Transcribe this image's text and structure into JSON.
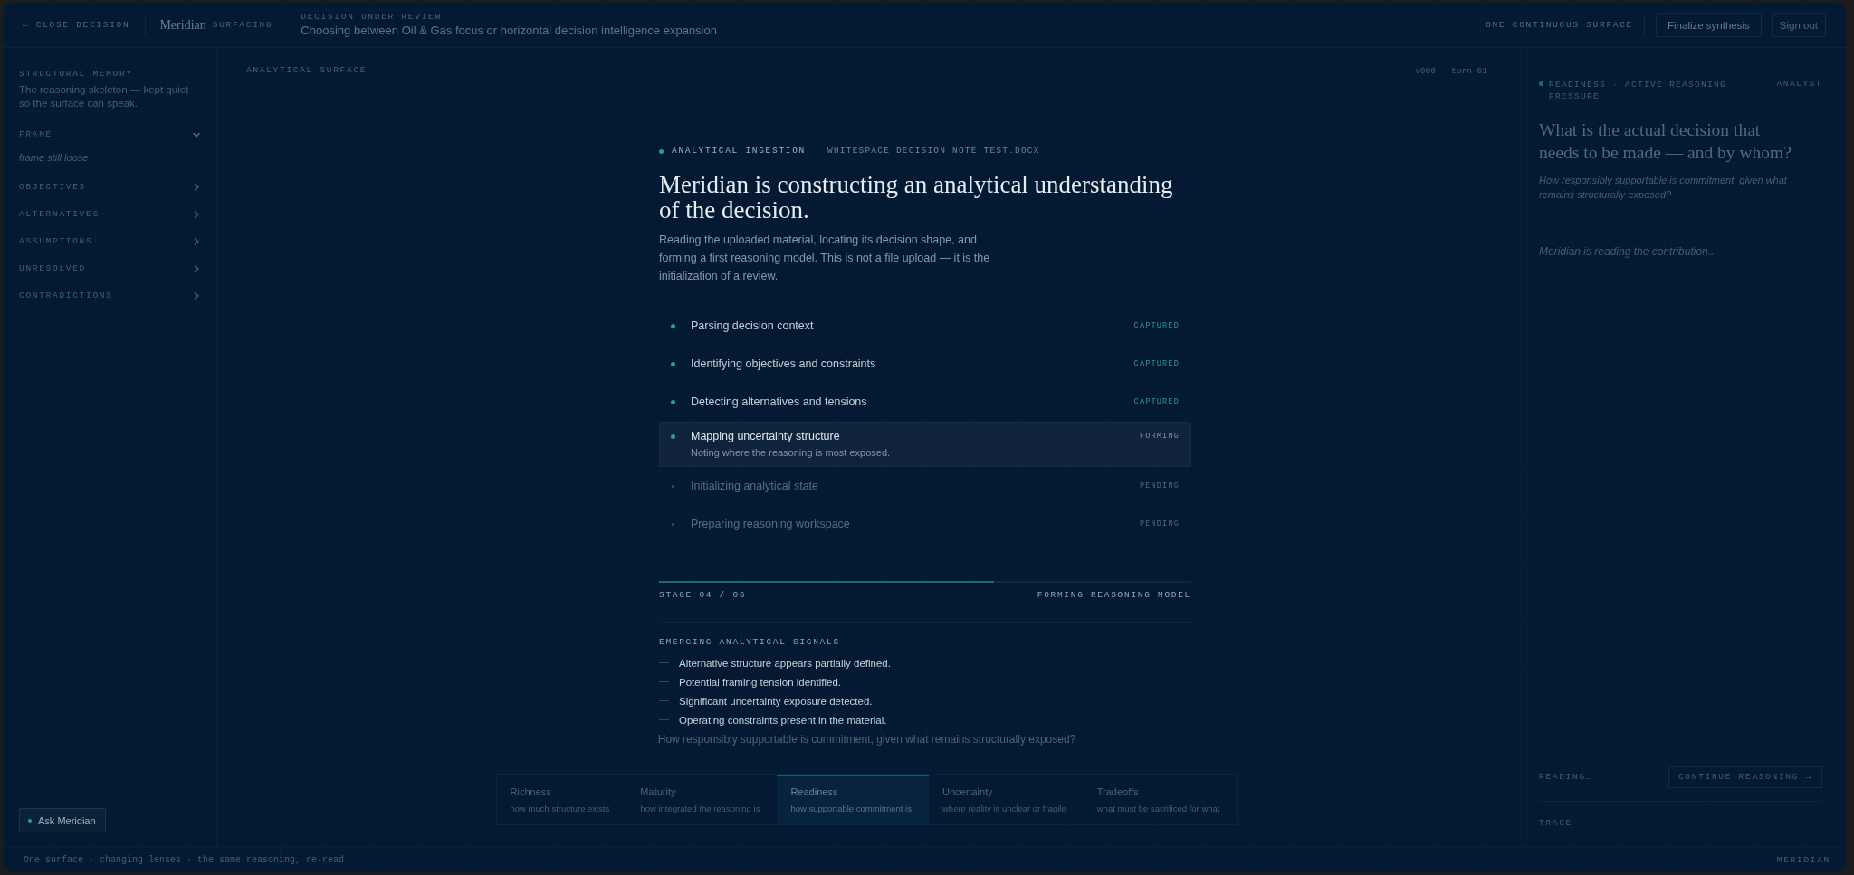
{
  "top_bar": {
    "close_link": "← CLOSE DECISION",
    "brand": "Meridian",
    "brand_mode": "SURFACING",
    "decision_label": "DECISION UNDER REVIEW",
    "decision_title": "Choosing between Oil & Gas focus or horizontal decision intelligence expansion",
    "surface_label": "ONE CONTINUOUS SURFACE",
    "finalize_button": "Finalize synthesis",
    "sign_out_button": "Sign out"
  },
  "sidebar": {
    "title": "STRUCTURAL MEMORY",
    "subtitle": "The reasoning skeleton — kept quiet so the surface can speak.",
    "sections": [
      {
        "label": "FRAME",
        "expanded": true,
        "note": "frame still loose"
      },
      {
        "label": "OBJECTIVES",
        "expanded": false
      },
      {
        "label": "ALTERNATIVES",
        "expanded": false
      },
      {
        "label": "ASSUMPTIONS",
        "expanded": false
      },
      {
        "label": "UNRESOLVED",
        "expanded": false
      },
      {
        "label": "CONTRADICTIONS",
        "expanded": false
      }
    ],
    "ask_button": "Ask Meridian"
  },
  "surface": {
    "title": "ANALYTICAL SURFACE",
    "version": "v000 · turn 01",
    "lens_question": "How responsibly supportable is commitment, given what remains structurally exposed?",
    "lenses": [
      {
        "name": "Richness",
        "description": "how much structure exists",
        "selected": false
      },
      {
        "name": "Maturity",
        "description": "how integrated the reasoning is",
        "selected": false
      },
      {
        "name": "Readiness",
        "description": "how supportable commitment is",
        "selected": true
      },
      {
        "name": "Uncertainty",
        "description": "where reality is unclear or fragile",
        "selected": false
      },
      {
        "name": "Tradeoffs",
        "description": "what must be sacrificed for what",
        "selected": false
      }
    ]
  },
  "reasoning_panel": {
    "tag": "READINESS · ACTIVE REASONING PRESSURE",
    "role": "ANALYST",
    "question": "What is the actual decision that needs to be made — and by whom?",
    "prompt": "How responsibly supportable is commitment, given what remains structurally exposed?",
    "status": "Meridian is reading the contribution...",
    "reading_label": "READING…",
    "continue_button": "CONTINUE REASONING →",
    "trace_label": "TRACE"
  },
  "footer": {
    "tagline": "One surface · changing lenses · the same reasoning, re-read",
    "brand": "MERIDIAN"
  },
  "ingestion": {
    "eyebrow": "ANALYTICAL INGESTION",
    "file_name": "WHITESPACE DECISION NOTE TEST.DOCX",
    "title": "Meridian is constructing an analytical understanding of the decision.",
    "description": "Reading the uploaded material, locating its decision shape, and forming a first reasoning model. This is not a file upload — it is the initialization of a review.",
    "steps": [
      {
        "label": "Parsing decision context",
        "status": "CAPTURED",
        "kind": "captured"
      },
      {
        "label": "Identifying objectives and constraints",
        "status": "CAPTURED",
        "kind": "captured"
      },
      {
        "label": "Detecting alternatives and tensions",
        "status": "CAPTURED",
        "kind": "captured"
      },
      {
        "label": "Mapping uncertainty structure",
        "detail": "Noting where the reasoning is most exposed.",
        "status": "FORMING",
        "kind": "forming"
      },
      {
        "label": "Initializing analytical state",
        "status": "PENDING",
        "kind": "pending"
      },
      {
        "label": "Preparing reasoning workspace",
        "status": "PENDING",
        "kind": "pending"
      }
    ],
    "level": 0.63,
    "stage": "STAGE 04 / 06",
    "stage_label": "FORMING REASONING MODEL",
    "signals_title": "EMERGING ANALYTICAL SIGNALS",
    "signals": [
      "Alternative structure appears partially defined.",
      "Potential framing tension identified.",
      "Significant uncertainty exposure detected.",
      "Operating constraints present in the material."
    ]
  }
}
